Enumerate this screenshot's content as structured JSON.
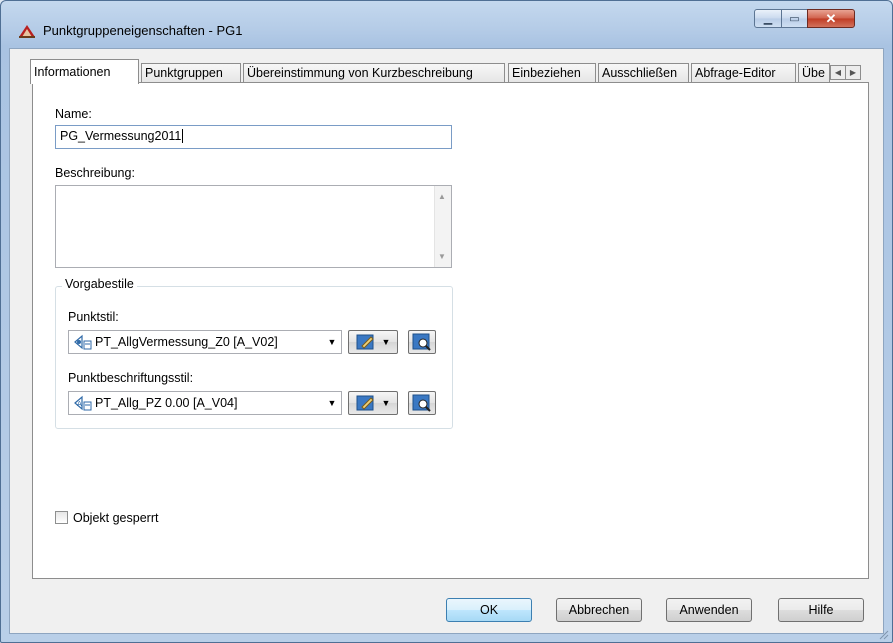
{
  "window": {
    "title": "Punktgruppeneigenschaften - PG1",
    "icon": "app-icon",
    "controls": {
      "minimize": "minimize-icon",
      "maximize": "maximize-icon",
      "close": "close-icon"
    }
  },
  "tabs": [
    {
      "label": "Informationen",
      "active": true
    },
    {
      "label": "Punktgruppen",
      "active": false
    },
    {
      "label": "Übereinstimmung von Kurzbeschreibung",
      "active": false
    },
    {
      "label": "Einbeziehen",
      "active": false
    },
    {
      "label": "Ausschließen",
      "active": false
    },
    {
      "label": "Abfrage-Editor",
      "active": false
    },
    {
      "label": "Übe",
      "active": false
    }
  ],
  "info": {
    "name_label": "Name:",
    "name_value": "PG_Vermessung2011",
    "description_label": "Beschreibung:",
    "description_value": ""
  },
  "styles": {
    "group_title": "Vorgabestile",
    "point_style_label": "Punktstil:",
    "point_style_value": "PT_AllgVermessung_Z0 [A_V02]",
    "label_style_label": "Punktbeschriftungsstil:",
    "label_style_value": "PT_Allg_PZ 0.00 [A_V04]"
  },
  "locked": {
    "label": "Objekt gesperrt",
    "checked": false
  },
  "buttons": {
    "ok": "OK",
    "cancel": "Abbrechen",
    "apply": "Anwenden",
    "help": "Hilfe"
  },
  "colors": {
    "accent": "#3c7fb1",
    "close": "#c03c24"
  }
}
